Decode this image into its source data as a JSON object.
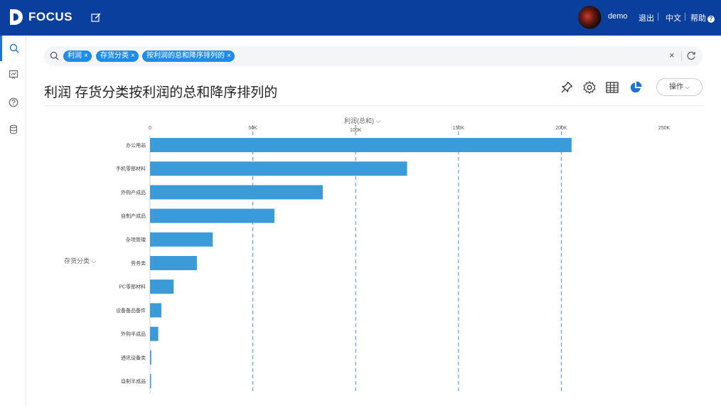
{
  "app": {
    "logo_text": "FOCUS"
  },
  "user": {
    "name": "demo"
  },
  "top_links": {
    "logout": "退出",
    "language": "中文",
    "help": "帮助"
  },
  "search": {
    "tokens": [
      {
        "label": "利润"
      },
      {
        "label": "存货分类"
      },
      {
        "label": "按利润的总和降序排列的"
      }
    ]
  },
  "title": "利润 存货分类按利润的总和降序排列的",
  "toolbar": {
    "operate_label": "操作"
  },
  "colors": {
    "topbar": "#0a3f9e",
    "bar": "#3a9bd8",
    "accent": "#1f8ce6"
  },
  "icons": {
    "sidebar": [
      "search-icon",
      "pin-board-icon",
      "help-icon",
      "data-icon"
    ],
    "toolbar": [
      "pin-icon",
      "gear-icon",
      "table-icon",
      "pie-chart-icon"
    ]
  },
  "chart_data": {
    "type": "bar",
    "orientation": "horizontal",
    "xlabel": "利润(总和)",
    "ylabel": "存货分类",
    "x_ticks": [
      "0",
      "50K",
      "100K",
      "150K",
      "200K",
      "250K"
    ],
    "x_tick_values": [
      0,
      50000,
      100000,
      150000,
      200000,
      250000
    ],
    "xlim": [
      0,
      250000
    ],
    "categories": [
      "办公用品",
      "手机零部材料",
      "外购产成品",
      "自制产成品",
      "杂项管理",
      "劳务类",
      "PC零部材料",
      "设备备品备件",
      "外购半成品",
      "通讯设备类",
      "自制半成品"
    ],
    "values": [
      205000,
      125000,
      84000,
      60500,
      30500,
      22800,
      11500,
      5500,
      4000,
      600,
      500
    ],
    "grid": "dashed vertical"
  }
}
